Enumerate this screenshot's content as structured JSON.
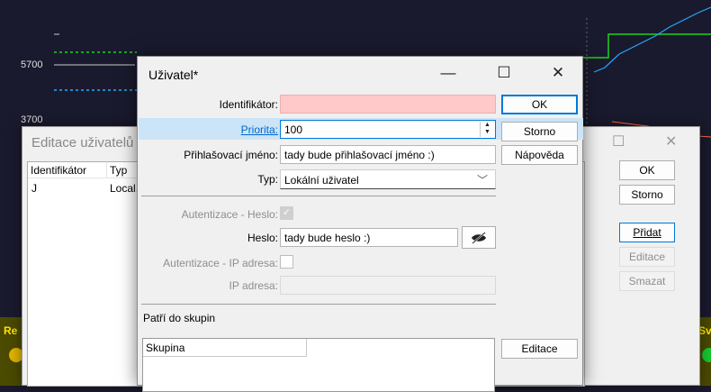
{
  "background_chart": {
    "y_ticks": [
      "5700",
      "3700"
    ],
    "status_left": "Re",
    "status_right": "Sv",
    "colors": {
      "bg": "#1a1a2e",
      "green": "#1fd21f",
      "cyan": "#29a7ff",
      "yellow": "#ffe100"
    }
  },
  "back_dialog": {
    "title": "Editace uživatelů",
    "window_buttons": [
      "minimize",
      "close"
    ],
    "columns": [
      "Identifikátor",
      "Typ"
    ],
    "rows": [
      {
        "id": "J",
        "type": "Local,I"
      }
    ],
    "buttons": {
      "ok": "OK",
      "cancel": "Storno",
      "add": "Přidat",
      "edit": "Editace",
      "delete": "Smazat"
    }
  },
  "dialog": {
    "title": "Uživatel*",
    "window_buttons": {
      "minimize": "—",
      "maximize": "☐",
      "close": "✕"
    },
    "labels": {
      "identifier": "Identifikátor:",
      "priority": "Priorita:",
      "login": "Přihlašovací jméno:",
      "type": "Typ:",
      "auth_password": "Autentizace - Heslo:",
      "password": "Heslo:",
      "auth_ip": "Autentizace - IP adresa:",
      "ip": "IP adresa:",
      "groups": "Patří do skupin"
    },
    "values": {
      "identifier": "",
      "priority": "100",
      "login": "tady bude přihlašovací jméno :)",
      "type": "Lokální uživatel",
      "auth_password_checked": true,
      "password": "tady bude heslo :)",
      "auth_ip_checked": false,
      "ip": ""
    },
    "buttons": {
      "ok": "OK",
      "cancel": "Storno",
      "help": "Nápověda",
      "edit_groups": "Editace"
    },
    "groups_grid": {
      "columns": [
        "Skupina"
      ]
    }
  }
}
